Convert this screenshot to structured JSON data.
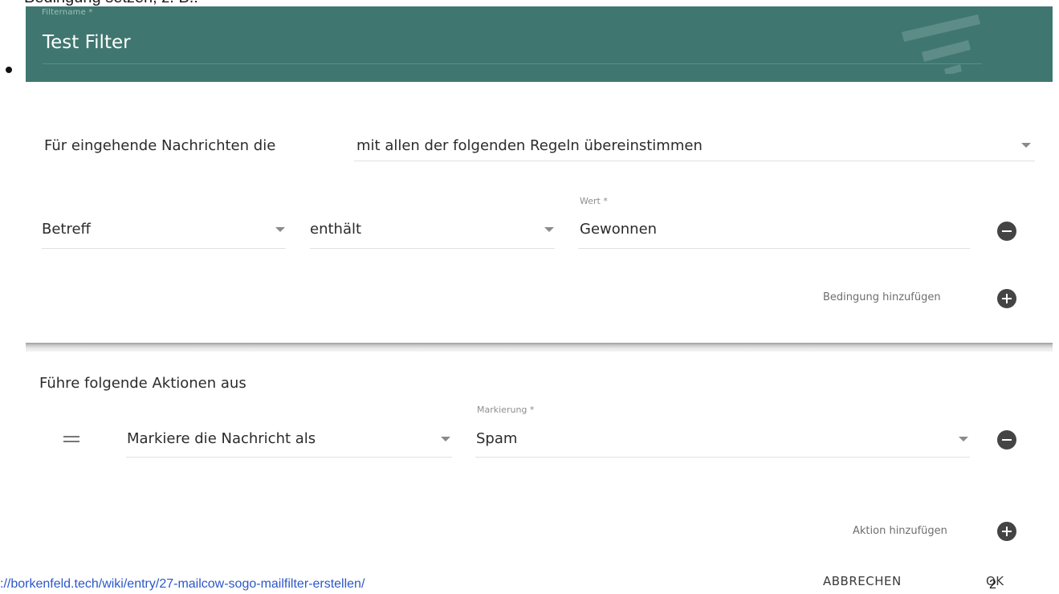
{
  "page_text": {
    "top_clipped": "Bedingung setzen, z. B.:",
    "bullet": "•"
  },
  "header": {
    "name_label": "Filtername *",
    "title": "Test Filter"
  },
  "match_row": {
    "label": "Für eingehende Nachrichten die",
    "selected": "mit allen der folgenden Regeln übereinstimmen"
  },
  "condition": {
    "field": "Betreff",
    "operator": "enthält",
    "value_label": "Wert *",
    "value": "Gewonnen"
  },
  "add_condition_label": "Bedingung hinzufügen",
  "actions": {
    "heading": "Führe folgende Aktionen aus",
    "action": "Markiere die Nachricht als",
    "flag_label": "Markierung *",
    "flag_value": "Spam",
    "add_action_label": "Aktion hinzufügen"
  },
  "footer": {
    "url": "://borkenfeld.tech/wiki/entry/27-mailcow-sogo-mailfilter-erstellen/",
    "cancel": "ABBRECHEN",
    "ok": "OK",
    "page_number": "2"
  },
  "colors": {
    "header_bg": "#3f7670",
    "accent_dark": "#444444",
    "link": "#2b57c9"
  },
  "icons": [
    "filter-icon",
    "caret-down-icon",
    "remove-icon",
    "add-icon",
    "drag-handle-icon"
  ]
}
